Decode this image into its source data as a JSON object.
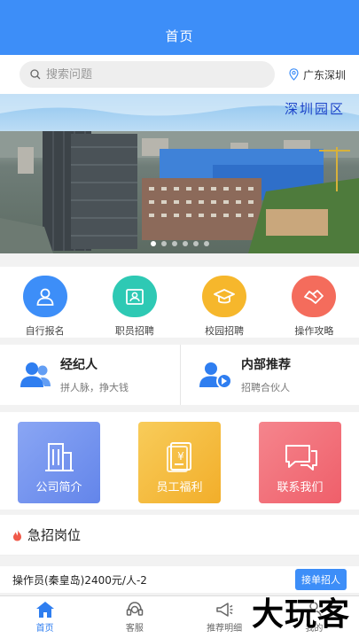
{
  "header": {
    "title": "首页"
  },
  "search": {
    "placeholder": "搜索问题"
  },
  "location": {
    "label": "广东深圳"
  },
  "banner": {
    "caption": "深圳园区",
    "slides": 6,
    "active": 0
  },
  "quick": [
    {
      "label": "自行报名",
      "icon": "person-icon",
      "color": "#3d8ef8"
    },
    {
      "label": "职员招聘",
      "icon": "id-card-icon",
      "color": "#2ec9b4"
    },
    {
      "label": "校园招聘",
      "icon": "graduation-cap-icon",
      "color": "#f6b72c"
    },
    {
      "label": "操作攻略",
      "icon": "handshake-icon",
      "color": "#f46c5c"
    }
  ],
  "agents": [
    {
      "title": "经纪人",
      "sub": "拼人脉，挣大钱",
      "icon": "users-icon"
    },
    {
      "title": "内部推荐",
      "sub": "招聘合伙人",
      "icon": "user-share-icon"
    }
  ],
  "cards": [
    {
      "label": "公司简介",
      "icon": "building-icon",
      "from": "#8aa6f4",
      "to": "#6385ea"
    },
    {
      "label": "员工福利",
      "icon": "receipt-icon",
      "from": "#f8cc5a",
      "to": "#f2ae2a"
    },
    {
      "label": "联系我们",
      "icon": "chat-icon",
      "from": "#f5858d",
      "to": "#ef5f6a"
    }
  ],
  "urgent": {
    "title": "急招岗位"
  },
  "job": {
    "title": "操作员(秦皇岛)2400元/人-2",
    "button": "接单招人"
  },
  "tabs": [
    {
      "label": "首页",
      "active": true
    },
    {
      "label": "客服",
      "active": false
    },
    {
      "label": "推荐明细",
      "active": false
    },
    {
      "label": "我的",
      "active": false
    }
  ],
  "watermark": "大玩客",
  "colors": {
    "primary": "#3d8ef8"
  }
}
